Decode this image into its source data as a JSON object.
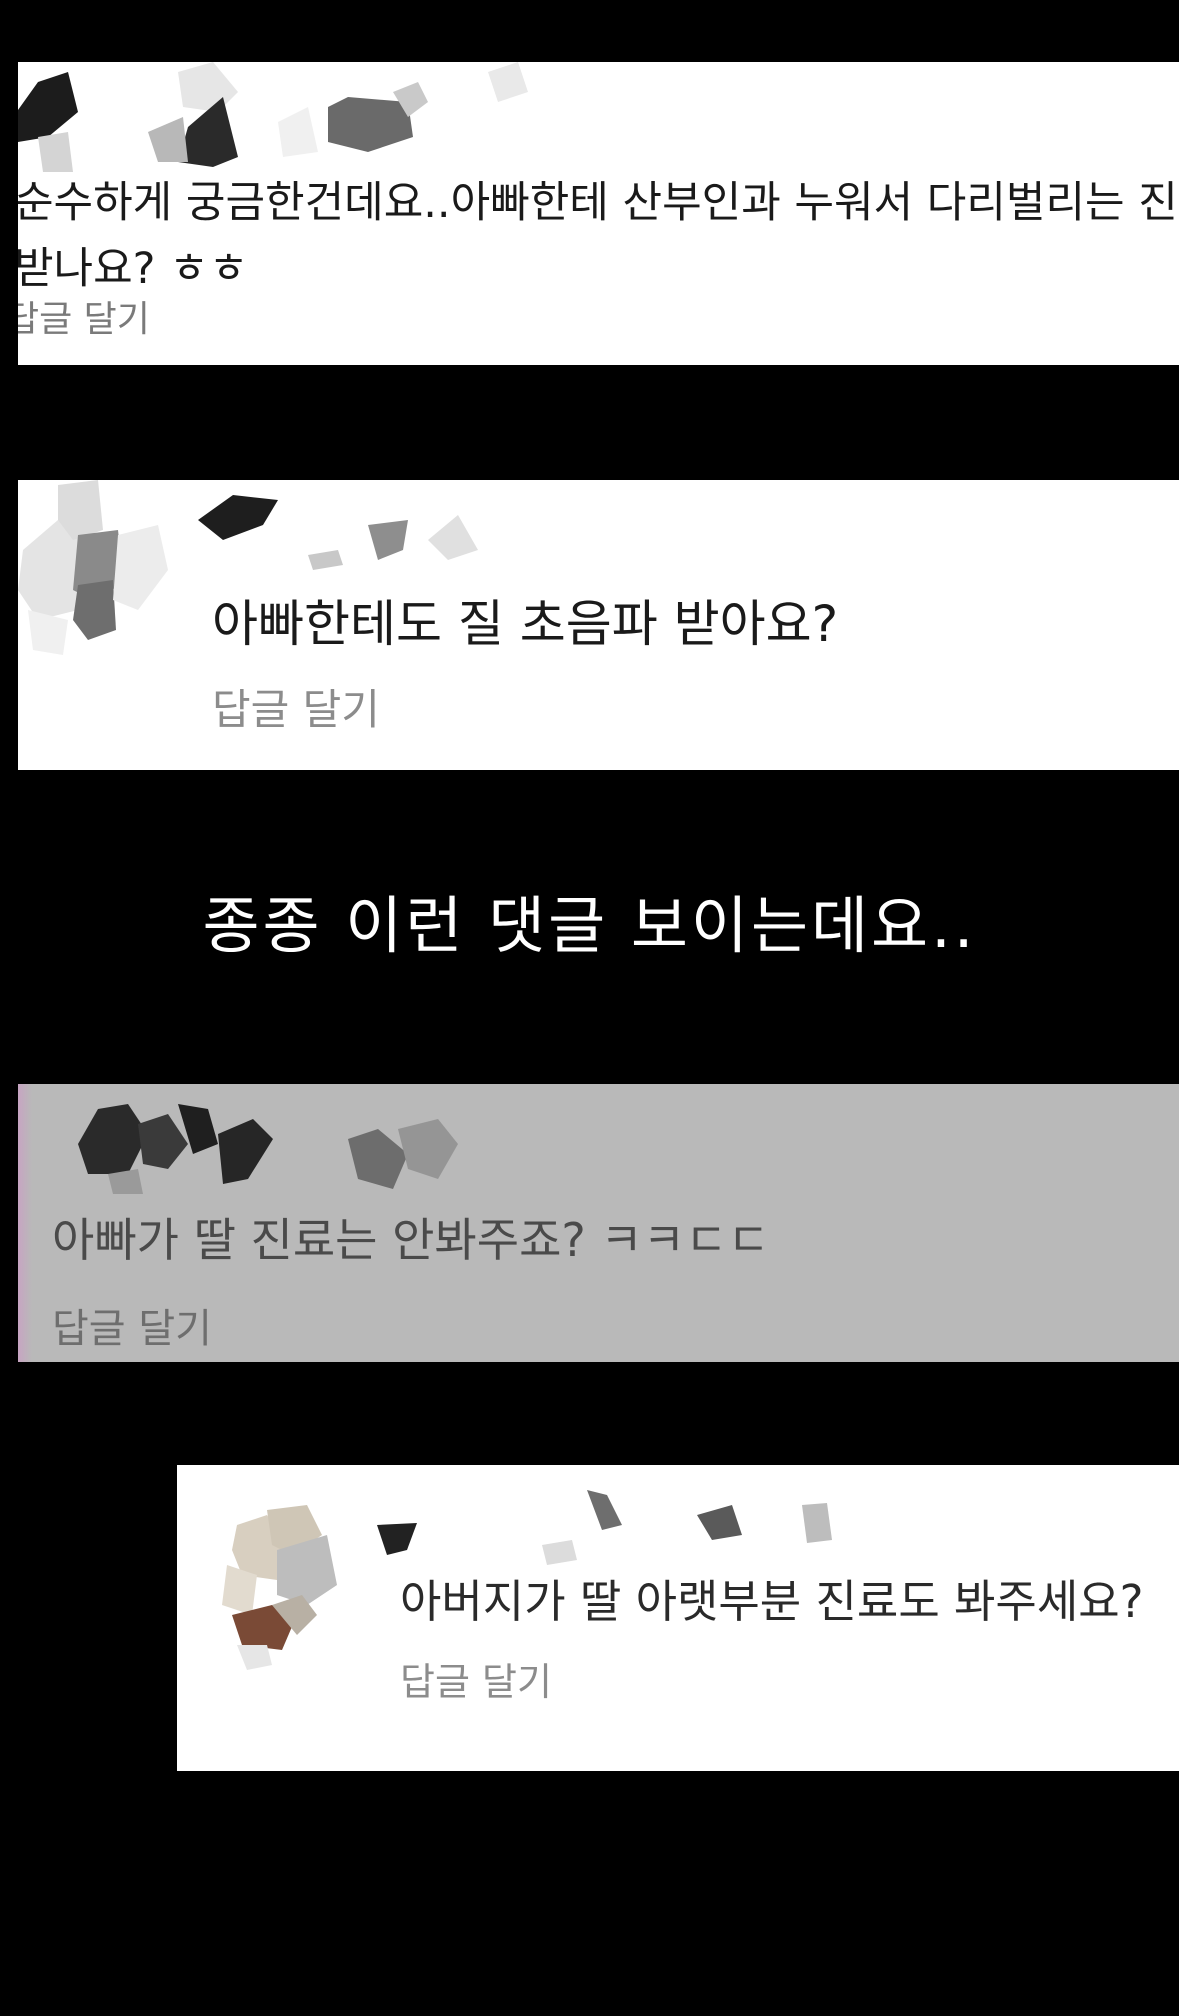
{
  "comments": [
    {
      "text_line1": "순수하게 궁금한건데요..아빠한테 산부인과 누워서 다리벌리는 진",
      "text_line2": "받나요? ㅎㅎ",
      "reply_label": "답글 달기"
    },
    {
      "text": "아빠한테도 질 초음파 받아요?",
      "reply_label": "답글 달기"
    },
    {
      "text": "아빠가 딸 진료는 안봐주죠? ㅋㅋㄷㄷ",
      "reply_label": "답글 달기"
    },
    {
      "text": "아버지가 딸 아랫부분 진료도 봐주세요?",
      "reply_label": "답글 달기"
    }
  ],
  "caption": "종종 이런 댓글 보이는데요..",
  "colors": {
    "background": "#000000",
    "card": "#ffffff",
    "dimmed_card": "#b9b9b9",
    "reply_text": "#8a8a8a",
    "caption_text": "#ffffff"
  },
  "icons": {
    "redacted_username": "mosaic-redaction",
    "redacted_avatar": "mosaic-avatar"
  }
}
